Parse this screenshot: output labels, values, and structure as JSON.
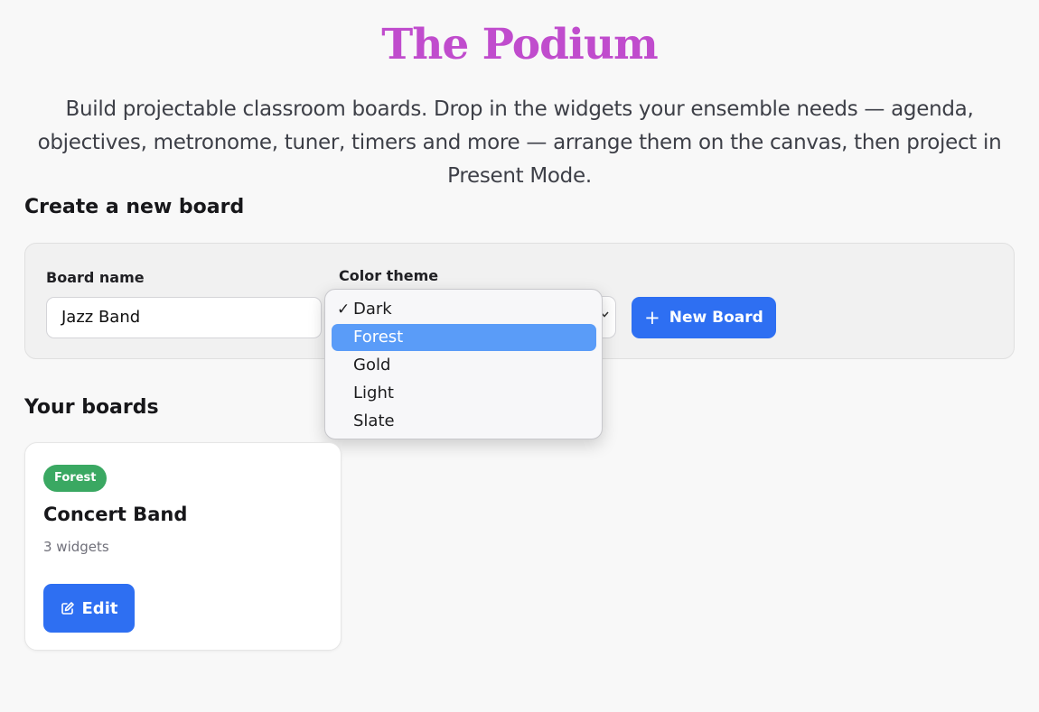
{
  "header": {
    "title": "The Podium",
    "subtitle": "Build projectable classroom boards. Drop in the widgets your ensemble needs — agenda, objectives, metronome, tuner, timers and more — arrange them on the canvas, then project in Present Mode."
  },
  "create": {
    "heading": "Create a new board",
    "board_name_label": "Board name",
    "board_name_value": "Jazz Band",
    "color_theme_label": "Color theme",
    "theme_dropdown": {
      "selected": "Dark",
      "highlighted": "Forest",
      "check": "✓",
      "options": [
        "Dark",
        "Forest",
        "Gold",
        "Light",
        "Slate"
      ]
    },
    "new_board_button": "New Board",
    "plus_glyph": "+"
  },
  "boards": {
    "heading": "Your boards",
    "items": [
      {
        "theme": "Forest",
        "theme_color": "#3aa862",
        "name": "Concert Band",
        "widgets": "3 widgets",
        "edit_label": "Edit"
      }
    ]
  },
  "colors": {
    "title": "#c04ccd",
    "primary_button": "#2e6ff2",
    "highlight": "#5a9cf8"
  },
  "icons": {
    "edit": "edit-icon",
    "plus": "plus-icon",
    "chevron": "chevron-down-icon",
    "check": "checkmark-icon"
  }
}
